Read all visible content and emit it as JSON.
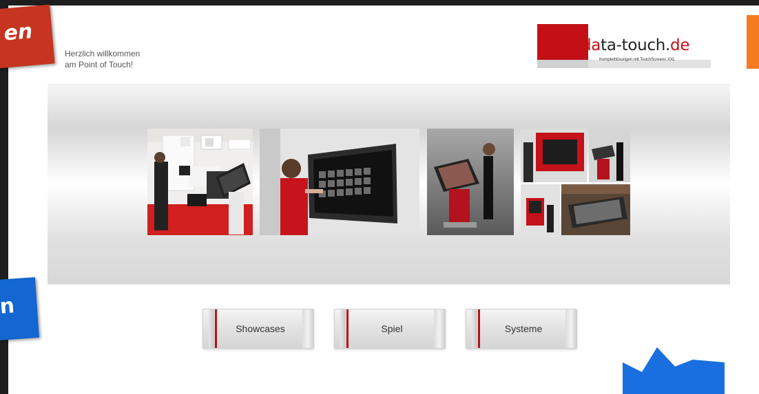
{
  "welcome": {
    "line1": "Herzlich willkommen",
    "line2": "am Point of Touch!"
  },
  "logo": {
    "part_red": "da",
    "part_dark": "ta-touch.",
    "part_tld": "de",
    "tagline": "Komplettlösungen mit TouchScreens XXL"
  },
  "nav_buttons": [
    {
      "label": "Showcases"
    },
    {
      "label": "Spiel"
    },
    {
      "label": "Systeme"
    }
  ],
  "stickers": {
    "red_text": "en",
    "blue_text": "n"
  },
  "colors": {
    "brand_red": "#c40f17",
    "sticker_red": "#c7341f",
    "sticker_blue": "#1466d0",
    "sticker_orange": "#f47b20",
    "crown_blue": "#1a6fe0"
  },
  "gallery": [
    {
      "icon": "trade-fair-booth-photo"
    },
    {
      "icon": "wall-touchscreen-photo"
    },
    {
      "icon": "touch-kiosk-photo"
    },
    {
      "icon": "red-touch-display-photo"
    },
    {
      "icon": "kiosk-user-photo"
    },
    {
      "icon": "red-kiosk-photo"
    },
    {
      "icon": "touch-table-photo"
    }
  ]
}
